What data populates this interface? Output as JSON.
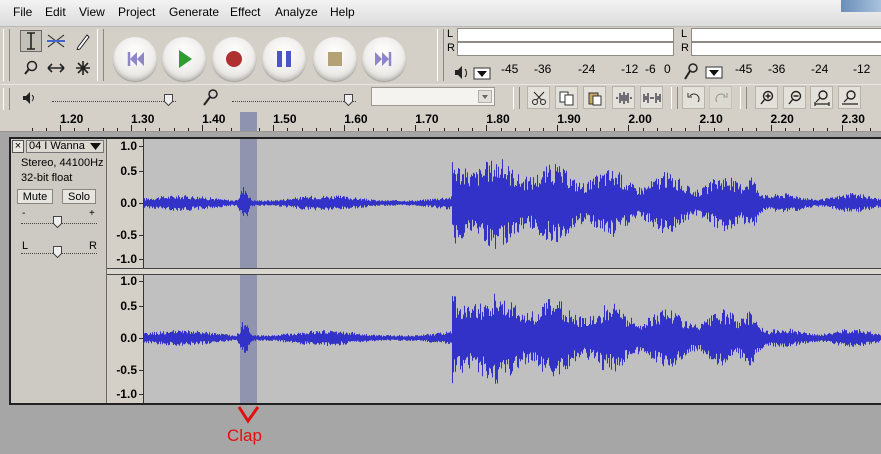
{
  "menubar": {
    "items": [
      "File",
      "Edit",
      "View",
      "Project",
      "Generate",
      "Effect",
      "Analyze",
      "Help"
    ]
  },
  "meters": {
    "playback": {
      "left": "L",
      "right": "R",
      "scale": [
        "-45",
        "-36",
        "-24",
        "-12",
        "-6",
        "0"
      ]
    },
    "record": {
      "left": "L",
      "right": "R",
      "scale": [
        "-45",
        "-36",
        "-24",
        "-12"
      ]
    }
  },
  "ruler": {
    "labels": [
      "1.20",
      "1.30",
      "1.40",
      "1.50",
      "1.60",
      "1.70",
      "1.80",
      "1.90",
      "2.00",
      "2.10",
      "2.20",
      "2.30"
    ]
  },
  "track": {
    "name": "04 I Wanna",
    "format": "Stereo, 44100Hz",
    "bitdepth": "32-bit float",
    "mute_label": "Mute",
    "solo_label": "Solo",
    "gain_minus": "-",
    "gain_plus": "+",
    "pan_left": "L",
    "pan_right": "R"
  },
  "amplitude_scale": [
    "1.0",
    "0.5",
    "0.0",
    "-0.5",
    "-1.0"
  ],
  "annotation": {
    "text": "Clap",
    "color": "#e01010"
  },
  "colors": {
    "waveform": "#3232c8",
    "selection": "#8d91ad",
    "accent_record": "#b03030",
    "accent_play": "#2e9c2e"
  }
}
